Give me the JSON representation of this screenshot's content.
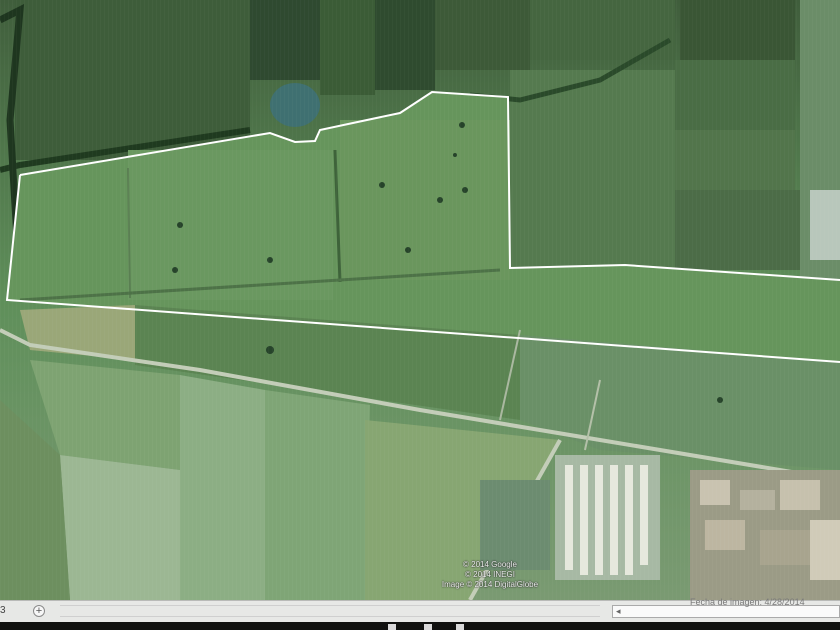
{
  "credits": {
    "line1": "© 2014 Google",
    "line2": "© 2014 INEGI",
    "line3": "Image © 2014 DigitalGlobe"
  },
  "statusbar": {
    "page_number": "3",
    "zoom_symbol": "+",
    "status_text": "Fecha de imagen: 4/28/2014",
    "scroll_arrow": "◂"
  },
  "colors": {
    "boundary": "#ffffff",
    "field_green": "#5f8f5a",
    "road": "#c8d2c0"
  },
  "icons": [
    "zoom-in-icon",
    "scroll-left-icon",
    "search-icon"
  ]
}
